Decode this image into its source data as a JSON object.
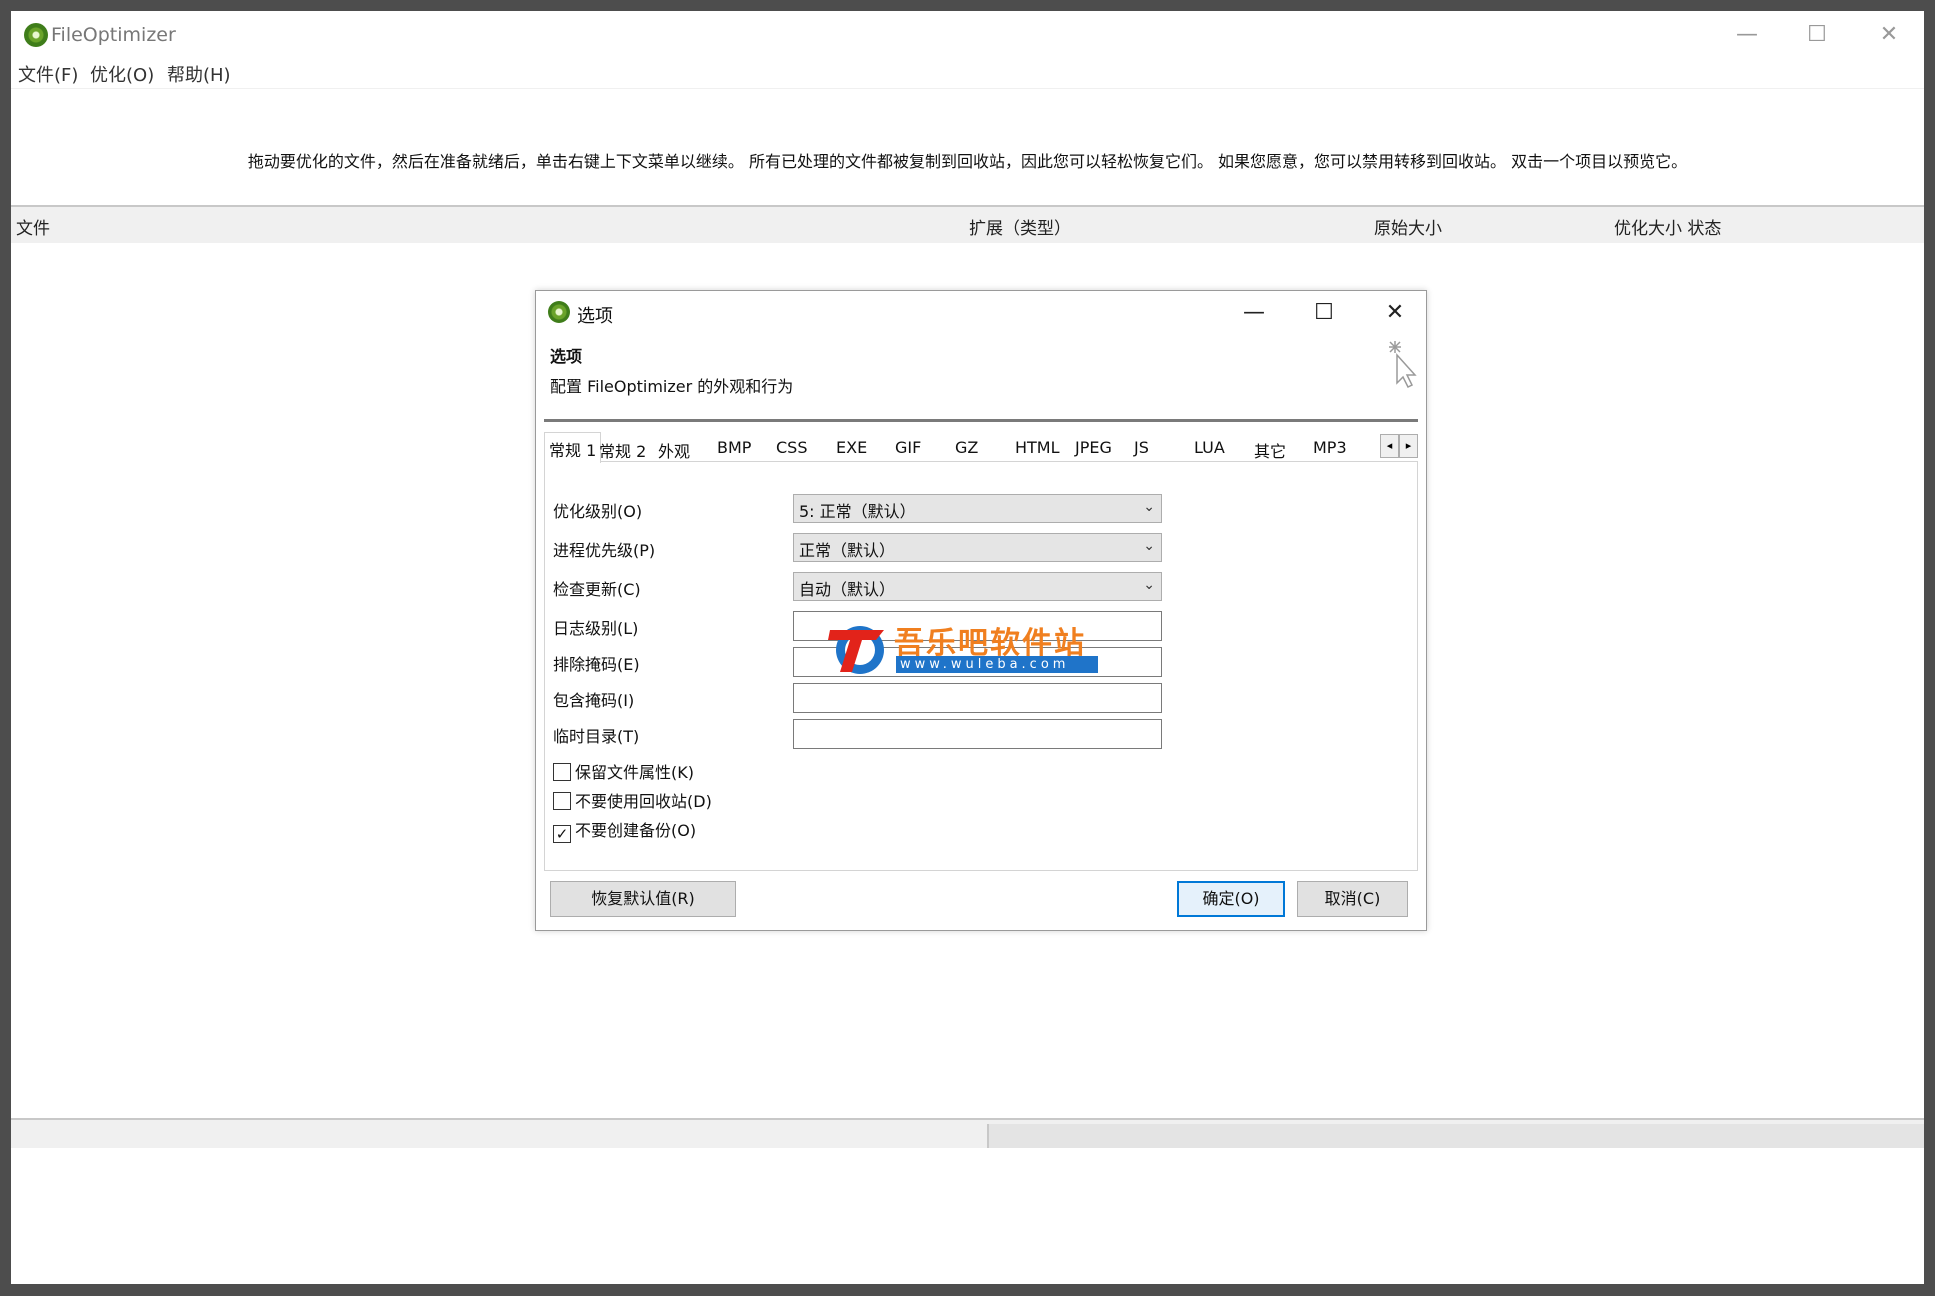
{
  "window": {
    "title": "FileOptimizer",
    "controls": {
      "minimize": "—",
      "maximize": "☐",
      "close": "✕"
    }
  },
  "menu": {
    "file": "文件(F)",
    "optimize": "优化(O)",
    "help": "帮助(H)"
  },
  "hint": "拖动要优化的文件，然后在准备就绪后，单击右键上下文菜单以继续。 所有已处理的文件都被复制到回收站，因此您可以轻松恢复它们。 如果您愿意，您可以禁用转移到回收站。 双击一个项目以预览它。",
  "list": {
    "columns": [
      "文件",
      "扩展（类型）",
      "原始大小",
      "优化大小 状态"
    ]
  },
  "dialog": {
    "title": "选项",
    "heading": "选项",
    "subtitle": "配置 FileOptimizer 的外观和行为",
    "controls": {
      "minimize": "—",
      "maximize": "☐",
      "close": "✕"
    },
    "tabs": [
      "常规 1",
      "常规 2",
      "外观",
      "BMP",
      "CSS",
      "EXE",
      "GIF",
      "GZ",
      "HTML",
      "JPEG",
      "JS",
      "LUA",
      "其它",
      "MP3"
    ],
    "active_tab": "常规 1",
    "tab_scroll": {
      "left": "◂",
      "right": "▸"
    },
    "fields": {
      "optimization_level": {
        "label": "优化级别(O)",
        "value": "5: 正常（默认）"
      },
      "process_priority": {
        "label": "进程优先级(P)",
        "value": "正常（默认）"
      },
      "check_updates": {
        "label": "检查更新(C)",
        "value": "自动（默认）"
      },
      "log_level": {
        "label": "日志级别(L)",
        "value": ""
      },
      "exclude_mask": {
        "label": "排除掩码(E)",
        "value": ""
      },
      "include_mask": {
        "label": "包含掩码(I)",
        "value": ""
      },
      "temp_dir": {
        "label": "临时目录(T)",
        "value": ""
      }
    },
    "checkboxes": {
      "keep_attributes": {
        "label": "保留文件属性(K)",
        "checked": false
      },
      "no_recycle_bin": {
        "label": "不要使用回收站(D)",
        "checked": false
      },
      "no_backup": {
        "label": "不要创建备份(O)",
        "checked": true
      }
    },
    "buttons": {
      "reset": "恢复默认值(R)",
      "ok": "确定(O)",
      "cancel": "取消(C)"
    }
  },
  "watermark": {
    "title": "吾乐吧软件站",
    "url": "www.wuleba.com"
  },
  "colors": {
    "frame": "#4d4d4d",
    "accent": "#0078d7",
    "watermark_orange": "#f07f1f",
    "watermark_blue": "#1f74c9"
  }
}
